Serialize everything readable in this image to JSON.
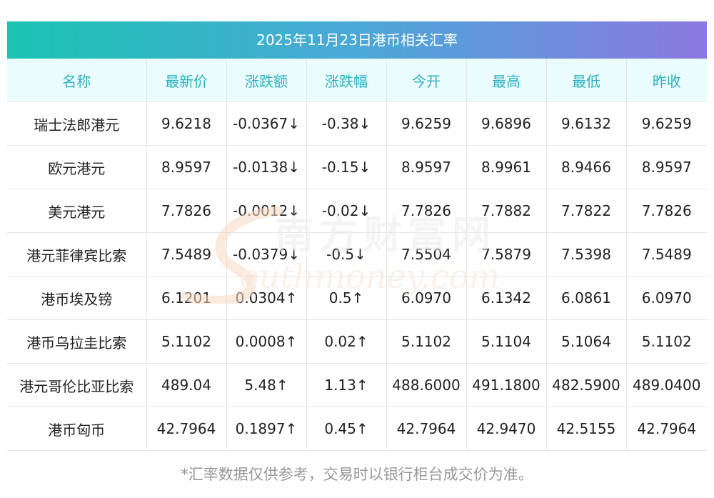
{
  "title": "2025年11月23日港币相关汇率",
  "headers": [
    "名称",
    "最新价",
    "涨跌额",
    "涨跌幅",
    "今开",
    "最高",
    "最低",
    "昨收"
  ],
  "rows": [
    {
      "name": "瑞士法郎港元",
      "latest": "9.6218",
      "change": "-0.0367↓",
      "pct": "-0.38↓",
      "open": "9.6259",
      "high": "9.6896",
      "low": "9.6132",
      "prev": "9.6259",
      "trend": "down"
    },
    {
      "name": "欧元港元",
      "latest": "8.9597",
      "change": "-0.0138↓",
      "pct": "-0.15↓",
      "open": "8.9597",
      "high": "8.9961",
      "low": "8.9466",
      "prev": "8.9597",
      "trend": "down"
    },
    {
      "name": "美元港元",
      "latest": "7.7826",
      "change": "-0.0012↓",
      "pct": "-0.02↓",
      "open": "7.7826",
      "high": "7.7882",
      "low": "7.7822",
      "prev": "7.7826",
      "trend": "down"
    },
    {
      "name": "港元菲律宾比索",
      "latest": "7.5489",
      "change": "-0.0379↓",
      "pct": "-0.5↓",
      "open": "7.5504",
      "high": "7.5879",
      "low": "7.5398",
      "prev": "7.5489",
      "trend": "down"
    },
    {
      "name": "港币埃及镑",
      "latest": "6.1201",
      "change": "0.0304↑",
      "pct": "0.5↑",
      "open": "6.0970",
      "high": "6.1342",
      "low": "6.0861",
      "prev": "6.0970",
      "trend": "up"
    },
    {
      "name": "港币乌拉圭比索",
      "latest": "5.1102",
      "change": "0.0008↑",
      "pct": "0.02↑",
      "open": "5.1102",
      "high": "5.1104",
      "low": "5.1064",
      "prev": "5.1102",
      "trend": "up"
    },
    {
      "name": "港元哥伦比亚比索",
      "latest": "489.04",
      "change": "5.48↑",
      "pct": "1.13↑",
      "open": "488.6000",
      "high": "491.1800",
      "low": "482.5900",
      "prev": "489.0400",
      "trend": "up"
    },
    {
      "name": "港币匈币",
      "latest": "42.7964",
      "change": "0.1897↑",
      "pct": "0.45↑",
      "open": "42.7964",
      "high": "42.9470",
      "low": "42.5155",
      "prev": "42.7964",
      "trend": "up"
    }
  ],
  "watermark": {
    "cn": "南方财富网",
    "en": "outhmoney.com"
  },
  "footnote": "*汇率数据仅供参考，交易时以银行柜台成交价为准。",
  "colors": {
    "up": "#e8140e",
    "down": "#1f8a1f",
    "header_text": "#2ab2c2",
    "header_bg": "#eafcfd"
  }
}
